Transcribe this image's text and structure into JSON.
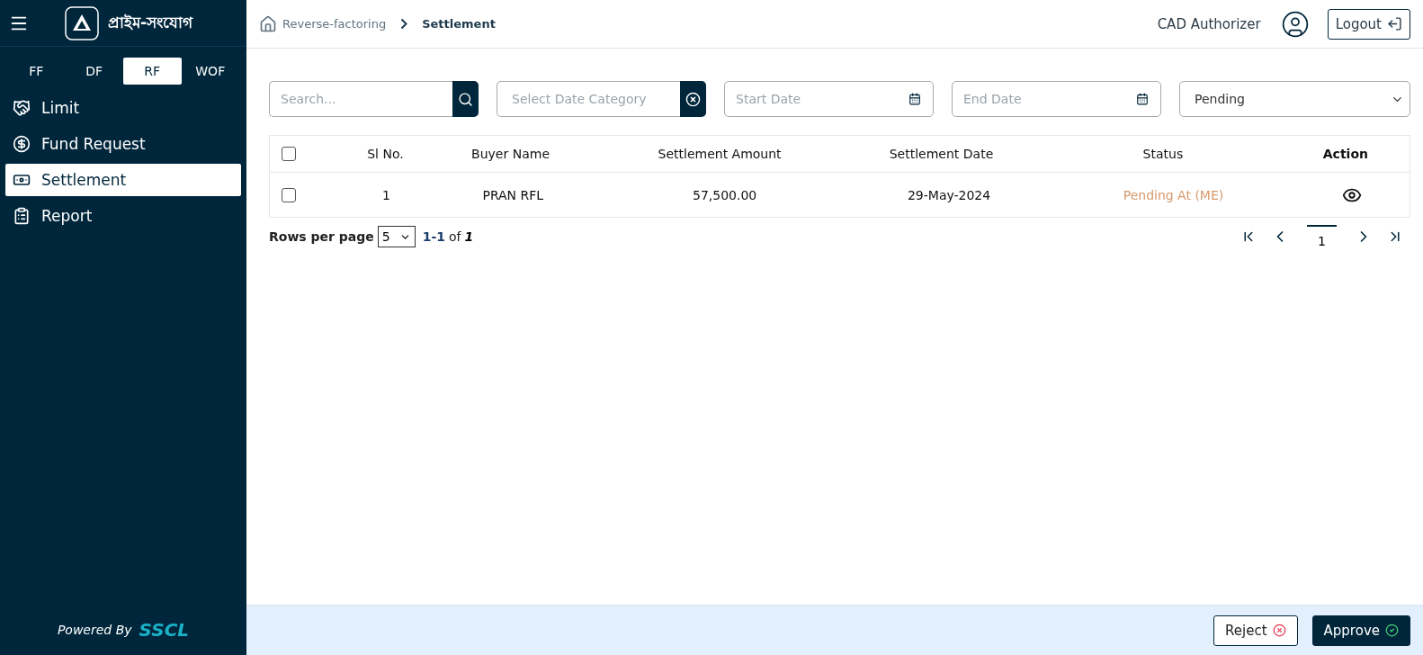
{
  "brand": {
    "name": "প্রাইম-সংযোগ"
  },
  "product_tabs": [
    {
      "label": "FF",
      "selected": false
    },
    {
      "label": "DF",
      "selected": false
    },
    {
      "label": "RF",
      "selected": true
    },
    {
      "label": "WOF",
      "selected": false
    }
  ],
  "nav": [
    {
      "label": "Limit",
      "selected": false
    },
    {
      "label": "Fund Request",
      "selected": false
    },
    {
      "label": "Settlement",
      "selected": true
    },
    {
      "label": "Report",
      "selected": false
    }
  ],
  "powered_by": {
    "label": "Powered By",
    "brand": "SSCL"
  },
  "breadcrumb": [
    {
      "label": "Reverse-factoring",
      "current": false
    },
    {
      "label": "Settlement",
      "current": true
    }
  ],
  "user": {
    "role": "CAD Authorizer",
    "logout": "Logout"
  },
  "filters": {
    "search_placeholder": "Search...",
    "date_category_placeholder": "Select Date Category",
    "start_date_placeholder": "Start Date",
    "end_date_placeholder": "End Date",
    "status": "Pending"
  },
  "table": {
    "all_checked": false,
    "columns": [
      "Sl No.",
      "Buyer Name",
      "Settlement Amount",
      "Settlement Date",
      "Status",
      "Action"
    ],
    "rows": [
      {
        "checked": false,
        "cells": [
          "1",
          "PRAN RFL",
          "57,500.00",
          "29-May-2024",
          "Pending At (ME)"
        ]
      }
    ]
  },
  "pagination": {
    "rows_per_page_label": "Rows per page",
    "rows_per_page": "5",
    "range": "1-1",
    "of": "of",
    "total": "1",
    "page": "1"
  },
  "actions": [
    {
      "kind": "reject",
      "label": "Reject"
    },
    {
      "kind": "approve",
      "label": "Approve"
    }
  ]
}
